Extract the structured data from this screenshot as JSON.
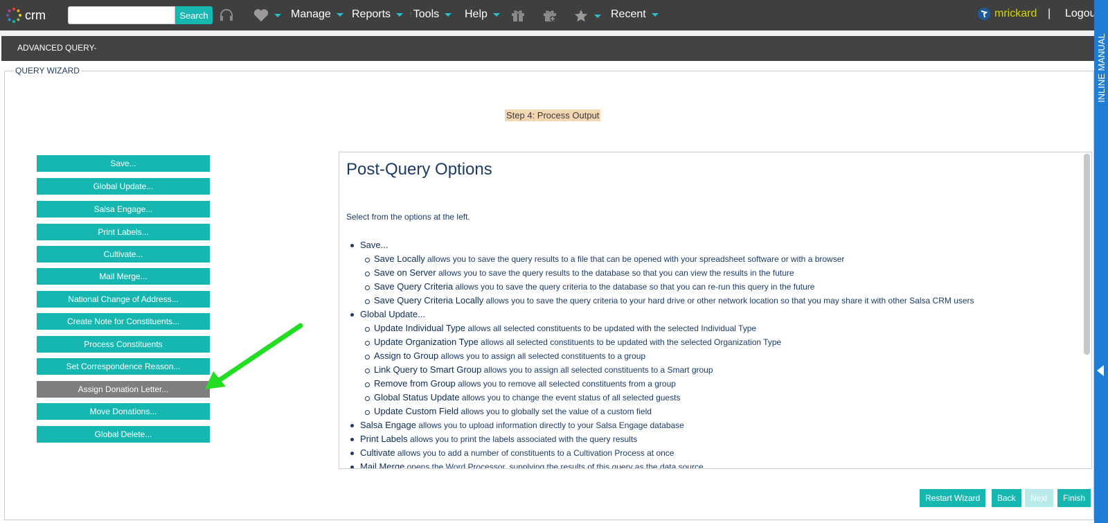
{
  "app": {
    "brand": "crm"
  },
  "header": {
    "search_placeholder": "",
    "search_label": "Search",
    "menus": [
      {
        "label": "Manage"
      },
      {
        "label": "Reports"
      },
      {
        "label": "Tools"
      },
      {
        "label": "Help"
      },
      {
        "label": "Recent"
      }
    ],
    "user_name": "mrickard",
    "separator": "|",
    "logout_label": "Logou"
  },
  "page": {
    "title": "ADVANCED QUERY-"
  },
  "inline_manual": {
    "label": "INLINE MANUAL"
  },
  "wizard": {
    "legend": "QUERY WIZARD",
    "step_label": "Step 4: Process Output",
    "options": [
      {
        "label": "Save..."
      },
      {
        "label": "Global Update..."
      },
      {
        "label": "Salsa Engage..."
      },
      {
        "label": "Print Labels..."
      },
      {
        "label": "Cultivate..."
      },
      {
        "label": "Mail Merge..."
      },
      {
        "label": "National Change of Address..."
      },
      {
        "label": "Create Note for Constituents..."
      },
      {
        "label": "Process Constituents"
      },
      {
        "label": "Set Correspondence Reason..."
      },
      {
        "label": "Assign Donation Letter..."
      },
      {
        "label": "Move Donations..."
      },
      {
        "label": "Global Delete..."
      }
    ],
    "selected_option": "Assign Donation Letter...",
    "panel": {
      "title": "Post-Query Options",
      "intro": "Select from the options at the left.",
      "items": [
        {
          "level": 1,
          "term": "Save...",
          "desc": ""
        },
        {
          "level": 2,
          "term": "Save Locally",
          "desc": " allows you to save the query results to a file that can be opened with your spreadsheet software or with a browser"
        },
        {
          "level": 2,
          "term": "Save on Server",
          "desc": " allows you to save the query results to the database so that you can view the results in the future"
        },
        {
          "level": 2,
          "term": "Save Query Criteria",
          "desc": " allows you to save the query criteria to the database so that you can re-run this query in the future"
        },
        {
          "level": 2,
          "term": "Save Query Criteria Locally",
          "desc": " allows you to save the query criteria to your hard drive or other network location so that you may share it with other Salsa CRM users"
        },
        {
          "level": 1,
          "term": "Global Update...",
          "desc": ""
        },
        {
          "level": 2,
          "term": "Update Individual Type",
          "desc": " allows all selected constituents to be updated with the selected Individual Type"
        },
        {
          "level": 2,
          "term": "Update Organization Type",
          "desc": " allows all selected constituents to be updated with the selected Organization Type"
        },
        {
          "level": 2,
          "term": "Assign to Group",
          "desc": " allows you to assign all selected constituents to a group"
        },
        {
          "level": 2,
          "term": "Link Query to Smart Group",
          "desc": " allows you to assign all selected constituents to a Smart group"
        },
        {
          "level": 2,
          "term": "Remove from Group",
          "desc": " allows you to remove all selected constituents from a group"
        },
        {
          "level": 2,
          "term": "Global Status Update",
          "desc": " allows you to change the event status of all selected guests"
        },
        {
          "level": 2,
          "term": "Update Custom Field",
          "desc": " allows you to globally set the value of a custom field"
        },
        {
          "level": 1,
          "term": "Salsa Engage",
          "desc": " allows you to upload information directly to your Salsa Engage database"
        },
        {
          "level": 1,
          "term": "Print Labels",
          "desc": " allows you to print the labels associated with the query results"
        },
        {
          "level": 1,
          "term": "Cultivate",
          "desc": " allows you to add a number of constituents to a Cultivation Process at once"
        },
        {
          "level": 1,
          "term": "Mail Merge",
          "desc": " opens the Word Processor, supplying the results of this query as the data source"
        }
      ]
    },
    "footer": {
      "restart": "Restart Wizard",
      "back": "Back",
      "next": "Next",
      "finish": "Finish"
    }
  },
  "colors": {
    "accent": "#17b7b1",
    "topbar": "#3f3f3f",
    "manual": "#1e7ed6",
    "arrow": "#22dd22"
  }
}
